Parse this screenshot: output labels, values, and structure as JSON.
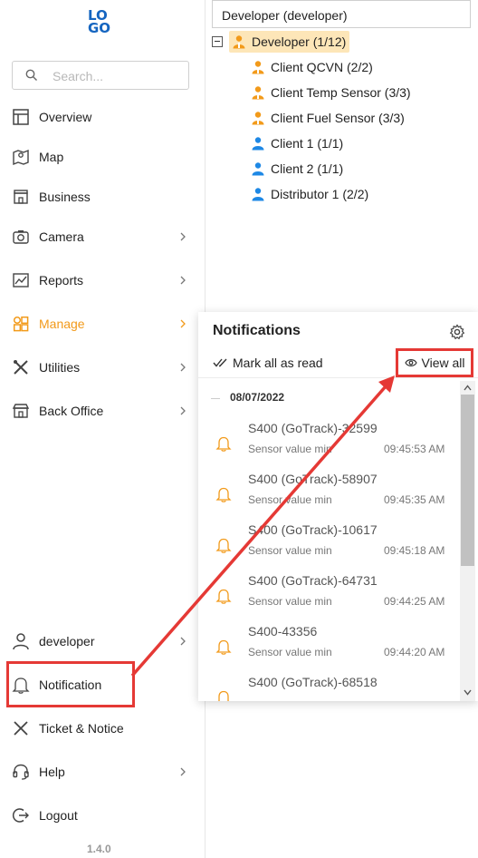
{
  "logo": {
    "row1": "LO",
    "row2": "GO"
  },
  "search": {
    "placeholder": "Search..."
  },
  "nav": [
    {
      "label": "Overview",
      "icon": "overview-icon",
      "chevron": false
    },
    {
      "label": "Map",
      "icon": "map-icon",
      "chevron": false
    },
    {
      "label": "Business",
      "icon": "store-icon",
      "chevron": false
    },
    {
      "label": "Camera",
      "icon": "camera-icon",
      "chevron": true
    },
    {
      "label": "Reports",
      "icon": "chart-icon",
      "chevron": true
    },
    {
      "label": "Manage",
      "icon": "grid-icon",
      "chevron": true,
      "active": true
    },
    {
      "label": "Utilities",
      "icon": "tools-icon",
      "chevron": true
    },
    {
      "label": "Back Office",
      "icon": "store-icon",
      "chevron": true
    }
  ],
  "bottom_nav": [
    {
      "label": "developer",
      "icon": "user-icon",
      "chevron": true
    },
    {
      "label": "Notification",
      "icon": "bell-icon",
      "chevron": false
    },
    {
      "label": "Ticket & Notice",
      "icon": "ticket-icon",
      "chevron": false
    },
    {
      "label": "Help",
      "icon": "headset-icon",
      "chevron": true
    },
    {
      "label": "Logout",
      "icon": "logout-icon",
      "chevron": false
    }
  ],
  "version": "1.4.0",
  "tree": {
    "select_value": "Developer (developer)",
    "root": "Developer (1/12)",
    "children": [
      {
        "label": "Client QCVN (2/2)",
        "color": "#f29a1a"
      },
      {
        "label": "Client Temp Sensor (3/3)",
        "color": "#f29a1a"
      },
      {
        "label": "Client Fuel Sensor (3/3)",
        "color": "#f29a1a"
      },
      {
        "label": "Client 1 (1/1)",
        "color": "#1e88e5"
      },
      {
        "label": "Client 2 (1/1)",
        "color": "#1e88e5"
      },
      {
        "label": "Distributor 1 (2/2)",
        "color": "#1e88e5"
      }
    ]
  },
  "notifications": {
    "title": "Notifications",
    "mark_all": "Mark all as read",
    "view_all": "View all",
    "date": "08/07/2022",
    "items": [
      {
        "title": "S400 (GoTrack)-32599",
        "subtitle": "Sensor value min",
        "time": "09:45:53 AM"
      },
      {
        "title": "S400 (GoTrack)-58907",
        "subtitle": "Sensor value min",
        "time": "09:45:35 AM"
      },
      {
        "title": "S400 (GoTrack)-10617",
        "subtitle": "Sensor value min",
        "time": "09:45:18 AM"
      },
      {
        "title": "S400 (GoTrack)-64731",
        "subtitle": "Sensor value min",
        "time": "09:44:25 AM"
      },
      {
        "title": "S400-43356",
        "subtitle": "Sensor value min",
        "time": "09:44:20 AM"
      },
      {
        "title": "S400 (GoTrack)-68518",
        "subtitle": "",
        "time": ""
      }
    ]
  },
  "colors": {
    "accent": "#f29a1a",
    "annotation": "#e53935",
    "brand": "#1565c0"
  }
}
